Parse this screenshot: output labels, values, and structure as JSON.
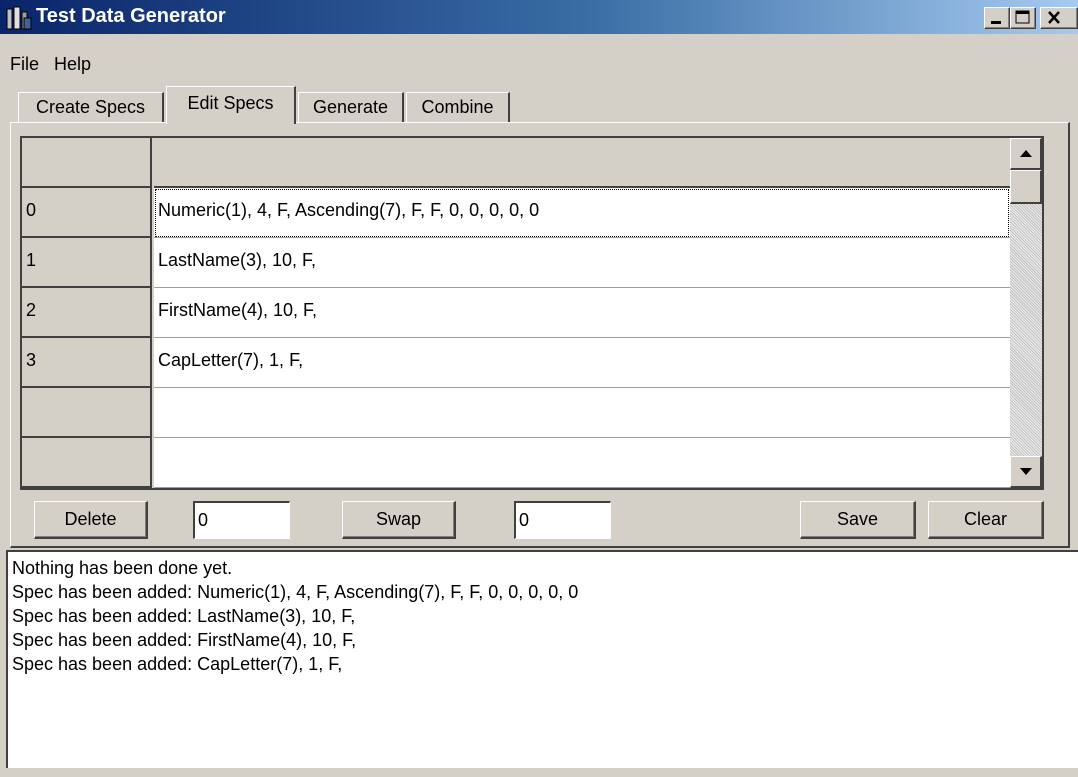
{
  "window": {
    "title": "Test Data Generator",
    "title_color": "#0a246a"
  },
  "menu": {
    "items": [
      "File",
      "Help"
    ]
  },
  "tabs": [
    {
      "label": "Create Specs",
      "active": false
    },
    {
      "label": "Edit Specs",
      "active": true
    },
    {
      "label": "Generate",
      "active": false
    },
    {
      "label": "Combine",
      "active": false
    }
  ],
  "grid": {
    "rows": [
      {
        "header": "0",
        "value": "Numeric(1), 4, F, Ascending(7), F, F, 0, 0, 0, 0, 0"
      },
      {
        "header": "1",
        "value": "LastName(3), 10, F,"
      },
      {
        "header": "2",
        "value": "FirstName(4), 10, F,"
      },
      {
        "header": "3",
        "value": "CapLetter(7), 1, F,"
      },
      {
        "header": "",
        "value": ""
      },
      {
        "header": "",
        "value": ""
      }
    ]
  },
  "controls": {
    "delete_label": "Delete",
    "delete_index": "0",
    "swap_label": "Swap",
    "swap_index": "0",
    "save_label": "Save",
    "clear_label": "Clear"
  },
  "log": [
    "Nothing has been done yet.",
    "Spec has been added: Numeric(1), 4, F, Ascending(7), F, F, 0, 0, 0, 0, 0",
    "Spec has been added: LastName(3), 10, F,",
    "Spec has been added: FirstName(4), 10, F,",
    "Spec has been added: CapLetter(7), 1, F,"
  ]
}
